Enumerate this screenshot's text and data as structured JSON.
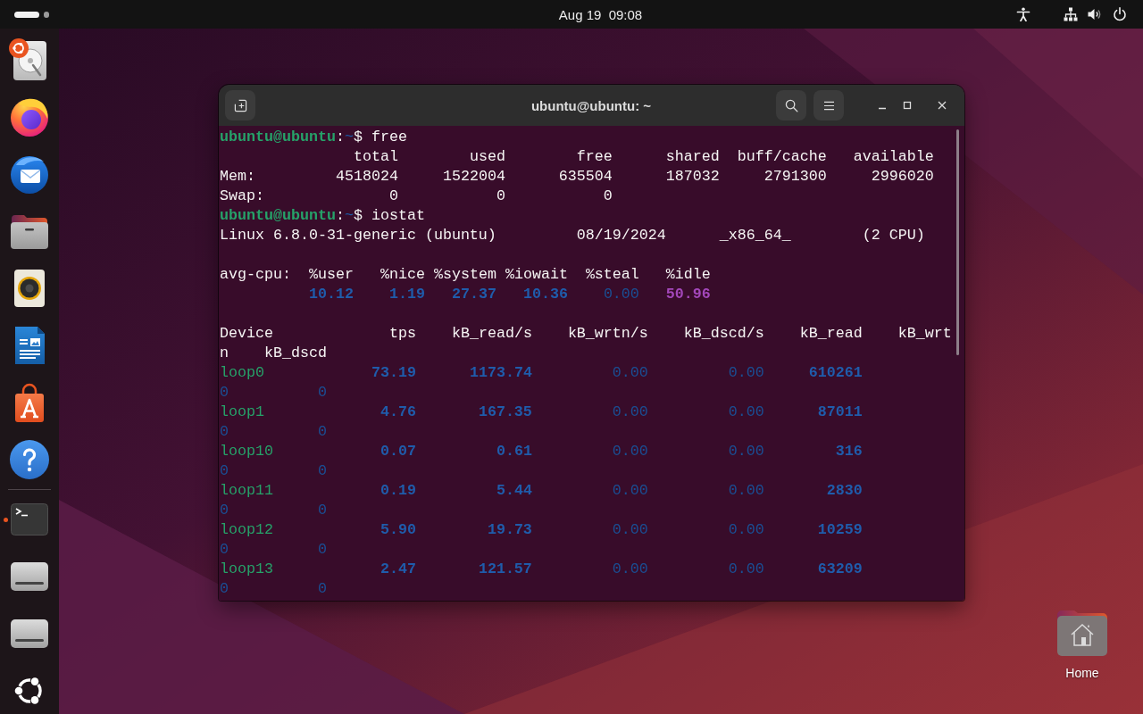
{
  "top_bar": {
    "workspaces": [
      {
        "selected": true
      },
      {
        "selected": false
      }
    ],
    "clock": "Aug 19  09:08"
  },
  "dock": {
    "groups": [
      {
        "items": [
          {
            "kind": "installer",
            "running": false
          },
          {
            "kind": "browser",
            "running": false
          },
          {
            "kind": "mail",
            "running": false
          },
          {
            "kind": "files",
            "running": false
          },
          {
            "kind": "music",
            "running": false
          },
          {
            "kind": "writer",
            "running": false
          },
          {
            "kind": "store",
            "running": false
          },
          {
            "kind": "help",
            "running": false
          }
        ]
      },
      {
        "items": [
          {
            "kind": "terminal",
            "running": true
          },
          {
            "kind": "drive",
            "running": false
          },
          {
            "kind": "drive",
            "running": false
          }
        ]
      }
    ]
  },
  "terminal": {
    "title": "ubuntu@ubuntu: ~",
    "lines": [
      {
        "kind": "prompt",
        "user": "ubuntu@ubuntu",
        "separator": ":",
        "path": "~",
        "symbol": "$",
        "command": "free"
      },
      {
        "kind": "output",
        "tokens": [
          {
            "kind": "heading",
            "text": "               total"
          },
          {
            "kind": "heading",
            "text": "        used"
          },
          {
            "kind": "heading",
            "text": "        free"
          },
          {
            "kind": "heading",
            "text": "      shared"
          },
          {
            "kind": "heading",
            "text": "  buff/cache"
          },
          {
            "kind": "heading",
            "text": "   available"
          }
        ]
      },
      {
        "kind": "output",
        "tokens": [
          {
            "kind": "label",
            "text": "Mem:"
          },
          {
            "kind": "number",
            "text": "         4518024"
          },
          {
            "kind": "number",
            "text": "     1522004"
          },
          {
            "kind": "number",
            "text": "      635504"
          },
          {
            "kind": "number",
            "text": "      187032"
          },
          {
            "kind": "number",
            "text": "     2791300"
          },
          {
            "kind": "number",
            "text": "     2996020"
          }
        ]
      },
      {
        "kind": "output",
        "tokens": [
          {
            "kind": "label",
            "text": "Swap:"
          },
          {
            "kind": "number",
            "text": "              0"
          },
          {
            "kind": "number",
            "text": "           0"
          },
          {
            "kind": "number",
            "text": "           0"
          }
        ]
      },
      {
        "kind": "prompt",
        "user": "ubuntu@ubuntu",
        "separator": ":",
        "path": "~",
        "symbol": "$",
        "command": "iostat"
      },
      {
        "kind": "output",
        "tokens": [
          {
            "kind": "text",
            "text": "Linux 6.8.0-31-generic (ubuntu)"
          },
          {
            "kind": "text",
            "text": "         08/19/2024"
          },
          {
            "kind": "text",
            "text": "      _x86_64_"
          },
          {
            "kind": "text",
            "text": "        (2 CPU)"
          }
        ]
      },
      {
        "kind": "blank"
      },
      {
        "kind": "output",
        "tokens": [
          {
            "kind": "label",
            "text": "avg-cpu:"
          },
          {
            "kind": "heading",
            "text": "  %user"
          },
          {
            "kind": "heading",
            "text": "   %nice"
          },
          {
            "kind": "heading",
            "text": " %system"
          },
          {
            "kind": "heading",
            "text": " %iowait"
          },
          {
            "kind": "heading",
            "text": "  %steal"
          },
          {
            "kind": "heading",
            "text": "   %idle"
          }
        ]
      },
      {
        "kind": "output",
        "tokens": [
          {
            "kind": "value",
            "text": "          10.12"
          },
          {
            "kind": "value",
            "text": "    1.19"
          },
          {
            "kind": "value",
            "text": "   27.37"
          },
          {
            "kind": "value",
            "text": "   10.36"
          },
          {
            "kind": "zero",
            "text": "    0.00"
          },
          {
            "kind": "peak",
            "text": "   50.96"
          }
        ]
      },
      {
        "kind": "blank"
      },
      {
        "kind": "output",
        "tokens": [
          {
            "kind": "heading",
            "text": "Device"
          },
          {
            "kind": "heading",
            "text": "             tps"
          },
          {
            "kind": "heading",
            "text": "    kB_read/s"
          },
          {
            "kind": "heading",
            "text": "    kB_wrtn/s"
          },
          {
            "kind": "heading",
            "text": "    kB_dscd/s"
          },
          {
            "kind": "heading",
            "text": "    kB_read"
          },
          {
            "kind": "heading",
            "text": "    kB_wrt"
          }
        ]
      },
      {
        "kind": "output",
        "tokens": [
          {
            "kind": "heading",
            "text": "n"
          },
          {
            "kind": "heading",
            "text": "    kB_dscd"
          }
        ]
      },
      {
        "kind": "output",
        "tokens": [
          {
            "kind": "device",
            "text": "loop0"
          },
          {
            "kind": "value",
            "text": "            73.19"
          },
          {
            "kind": "value",
            "text": "      1173.74"
          },
          {
            "kind": "zero",
            "text": "         0.00"
          },
          {
            "kind": "zero",
            "text": "         0.00"
          },
          {
            "kind": "value",
            "text": "     610261"
          }
        ]
      },
      {
        "kind": "output",
        "tokens": [
          {
            "kind": "zero",
            "text": "0"
          },
          {
            "kind": "zero",
            "text": "          0"
          }
        ]
      },
      {
        "kind": "output",
        "tokens": [
          {
            "kind": "device",
            "text": "loop1"
          },
          {
            "kind": "value",
            "text": "             4.76"
          },
          {
            "kind": "value",
            "text": "       167.35"
          },
          {
            "kind": "zero",
            "text": "         0.00"
          },
          {
            "kind": "zero",
            "text": "         0.00"
          },
          {
            "kind": "value",
            "text": "      87011"
          }
        ]
      },
      {
        "kind": "output",
        "tokens": [
          {
            "kind": "zero",
            "text": "0"
          },
          {
            "kind": "zero",
            "text": "          0"
          }
        ]
      },
      {
        "kind": "output",
        "tokens": [
          {
            "kind": "device",
            "text": "loop10"
          },
          {
            "kind": "value",
            "text": "            0.07"
          },
          {
            "kind": "value",
            "text": "         0.61"
          },
          {
            "kind": "zero",
            "text": "         0.00"
          },
          {
            "kind": "zero",
            "text": "         0.00"
          },
          {
            "kind": "value",
            "text": "        316"
          }
        ]
      },
      {
        "kind": "output",
        "tokens": [
          {
            "kind": "zero",
            "text": "0"
          },
          {
            "kind": "zero",
            "text": "          0"
          }
        ]
      },
      {
        "kind": "output",
        "tokens": [
          {
            "kind": "device",
            "text": "loop11"
          },
          {
            "kind": "value",
            "text": "            0.19"
          },
          {
            "kind": "value",
            "text": "         5.44"
          },
          {
            "kind": "zero",
            "text": "         0.00"
          },
          {
            "kind": "zero",
            "text": "         0.00"
          },
          {
            "kind": "value",
            "text": "       2830"
          }
        ]
      },
      {
        "kind": "output",
        "tokens": [
          {
            "kind": "zero",
            "text": "0"
          },
          {
            "kind": "zero",
            "text": "          0"
          }
        ]
      },
      {
        "kind": "output",
        "tokens": [
          {
            "kind": "device",
            "text": "loop12"
          },
          {
            "kind": "value",
            "text": "            5.90"
          },
          {
            "kind": "value",
            "text": "        19.73"
          },
          {
            "kind": "zero",
            "text": "         0.00"
          },
          {
            "kind": "zero",
            "text": "         0.00"
          },
          {
            "kind": "value",
            "text": "      10259"
          }
        ]
      },
      {
        "kind": "output",
        "tokens": [
          {
            "kind": "zero",
            "text": "0"
          },
          {
            "kind": "zero",
            "text": "          0"
          }
        ]
      },
      {
        "kind": "output",
        "tokens": [
          {
            "kind": "device",
            "text": "loop13"
          },
          {
            "kind": "value",
            "text": "            2.47"
          },
          {
            "kind": "value",
            "text": "       121.57"
          },
          {
            "kind": "zero",
            "text": "         0.00"
          },
          {
            "kind": "zero",
            "text": "         0.00"
          },
          {
            "kind": "value",
            "text": "      63209"
          }
        ]
      },
      {
        "kind": "output",
        "tokens": [
          {
            "kind": "zero",
            "text": "0"
          },
          {
            "kind": "zero",
            "text": "          0"
          }
        ]
      }
    ]
  },
  "desktop": {
    "icons": [
      {
        "label": "Home"
      }
    ]
  }
}
